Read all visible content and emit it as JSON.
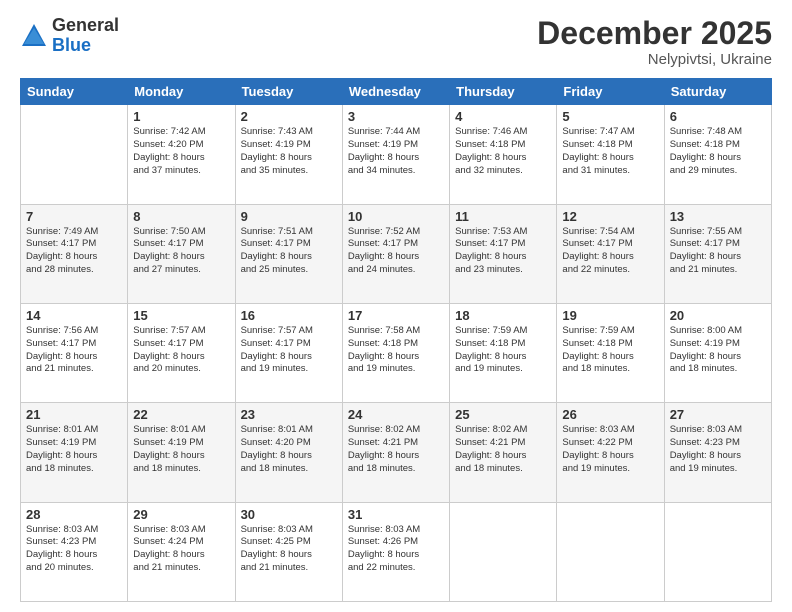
{
  "logo": {
    "general": "General",
    "blue": "Blue"
  },
  "header": {
    "month": "December 2025",
    "location": "Nelypivtsi, Ukraine"
  },
  "days_of_week": [
    "Sunday",
    "Monday",
    "Tuesday",
    "Wednesday",
    "Thursday",
    "Friday",
    "Saturday"
  ],
  "weeks": [
    [
      {
        "day": "",
        "sunrise": "",
        "sunset": "",
        "daylight": ""
      },
      {
        "day": "1",
        "sunrise": "Sunrise: 7:42 AM",
        "sunset": "Sunset: 4:20 PM",
        "daylight": "Daylight: 8 hours and 37 minutes."
      },
      {
        "day": "2",
        "sunrise": "Sunrise: 7:43 AM",
        "sunset": "Sunset: 4:19 PM",
        "daylight": "Daylight: 8 hours and 35 minutes."
      },
      {
        "day": "3",
        "sunrise": "Sunrise: 7:44 AM",
        "sunset": "Sunset: 4:19 PM",
        "daylight": "Daylight: 8 hours and 34 minutes."
      },
      {
        "day": "4",
        "sunrise": "Sunrise: 7:46 AM",
        "sunset": "Sunset: 4:18 PM",
        "daylight": "Daylight: 8 hours and 32 minutes."
      },
      {
        "day": "5",
        "sunrise": "Sunrise: 7:47 AM",
        "sunset": "Sunset: 4:18 PM",
        "daylight": "Daylight: 8 hours and 31 minutes."
      },
      {
        "day": "6",
        "sunrise": "Sunrise: 7:48 AM",
        "sunset": "Sunset: 4:18 PM",
        "daylight": "Daylight: 8 hours and 29 minutes."
      }
    ],
    [
      {
        "day": "7",
        "sunrise": "Sunrise: 7:49 AM",
        "sunset": "Sunset: 4:17 PM",
        "daylight": "Daylight: 8 hours and 28 minutes."
      },
      {
        "day": "8",
        "sunrise": "Sunrise: 7:50 AM",
        "sunset": "Sunset: 4:17 PM",
        "daylight": "Daylight: 8 hours and 27 minutes."
      },
      {
        "day": "9",
        "sunrise": "Sunrise: 7:51 AM",
        "sunset": "Sunset: 4:17 PM",
        "daylight": "Daylight: 8 hours and 25 minutes."
      },
      {
        "day": "10",
        "sunrise": "Sunrise: 7:52 AM",
        "sunset": "Sunset: 4:17 PM",
        "daylight": "Daylight: 8 hours and 24 minutes."
      },
      {
        "day": "11",
        "sunrise": "Sunrise: 7:53 AM",
        "sunset": "Sunset: 4:17 PM",
        "daylight": "Daylight: 8 hours and 23 minutes."
      },
      {
        "day": "12",
        "sunrise": "Sunrise: 7:54 AM",
        "sunset": "Sunset: 4:17 PM",
        "daylight": "Daylight: 8 hours and 22 minutes."
      },
      {
        "day": "13",
        "sunrise": "Sunrise: 7:55 AM",
        "sunset": "Sunset: 4:17 PM",
        "daylight": "Daylight: 8 hours and 21 minutes."
      }
    ],
    [
      {
        "day": "14",
        "sunrise": "Sunrise: 7:56 AM",
        "sunset": "Sunset: 4:17 PM",
        "daylight": "Daylight: 8 hours and 21 minutes."
      },
      {
        "day": "15",
        "sunrise": "Sunrise: 7:57 AM",
        "sunset": "Sunset: 4:17 PM",
        "daylight": "Daylight: 8 hours and 20 minutes."
      },
      {
        "day": "16",
        "sunrise": "Sunrise: 7:57 AM",
        "sunset": "Sunset: 4:17 PM",
        "daylight": "Daylight: 8 hours and 19 minutes."
      },
      {
        "day": "17",
        "sunrise": "Sunrise: 7:58 AM",
        "sunset": "Sunset: 4:18 PM",
        "daylight": "Daylight: 8 hours and 19 minutes."
      },
      {
        "day": "18",
        "sunrise": "Sunrise: 7:59 AM",
        "sunset": "Sunset: 4:18 PM",
        "daylight": "Daylight: 8 hours and 19 minutes."
      },
      {
        "day": "19",
        "sunrise": "Sunrise: 7:59 AM",
        "sunset": "Sunset: 4:18 PM",
        "daylight": "Daylight: 8 hours and 18 minutes."
      },
      {
        "day": "20",
        "sunrise": "Sunrise: 8:00 AM",
        "sunset": "Sunset: 4:19 PM",
        "daylight": "Daylight: 8 hours and 18 minutes."
      }
    ],
    [
      {
        "day": "21",
        "sunrise": "Sunrise: 8:01 AM",
        "sunset": "Sunset: 4:19 PM",
        "daylight": "Daylight: 8 hours and 18 minutes."
      },
      {
        "day": "22",
        "sunrise": "Sunrise: 8:01 AM",
        "sunset": "Sunset: 4:19 PM",
        "daylight": "Daylight: 8 hours and 18 minutes."
      },
      {
        "day": "23",
        "sunrise": "Sunrise: 8:01 AM",
        "sunset": "Sunset: 4:20 PM",
        "daylight": "Daylight: 8 hours and 18 minutes."
      },
      {
        "day": "24",
        "sunrise": "Sunrise: 8:02 AM",
        "sunset": "Sunset: 4:21 PM",
        "daylight": "Daylight: 8 hours and 18 minutes."
      },
      {
        "day": "25",
        "sunrise": "Sunrise: 8:02 AM",
        "sunset": "Sunset: 4:21 PM",
        "daylight": "Daylight: 8 hours and 18 minutes."
      },
      {
        "day": "26",
        "sunrise": "Sunrise: 8:03 AM",
        "sunset": "Sunset: 4:22 PM",
        "daylight": "Daylight: 8 hours and 19 minutes."
      },
      {
        "day": "27",
        "sunrise": "Sunrise: 8:03 AM",
        "sunset": "Sunset: 4:23 PM",
        "daylight": "Daylight: 8 hours and 19 minutes."
      }
    ],
    [
      {
        "day": "28",
        "sunrise": "Sunrise: 8:03 AM",
        "sunset": "Sunset: 4:23 PM",
        "daylight": "Daylight: 8 hours and 20 minutes."
      },
      {
        "day": "29",
        "sunrise": "Sunrise: 8:03 AM",
        "sunset": "Sunset: 4:24 PM",
        "daylight": "Daylight: 8 hours and 21 minutes."
      },
      {
        "day": "30",
        "sunrise": "Sunrise: 8:03 AM",
        "sunset": "Sunset: 4:25 PM",
        "daylight": "Daylight: 8 hours and 21 minutes."
      },
      {
        "day": "31",
        "sunrise": "Sunrise: 8:03 AM",
        "sunset": "Sunset: 4:26 PM",
        "daylight": "Daylight: 8 hours and 22 minutes."
      },
      {
        "day": "",
        "sunrise": "",
        "sunset": "",
        "daylight": ""
      },
      {
        "day": "",
        "sunrise": "",
        "sunset": "",
        "daylight": ""
      },
      {
        "day": "",
        "sunrise": "",
        "sunset": "",
        "daylight": ""
      }
    ]
  ]
}
